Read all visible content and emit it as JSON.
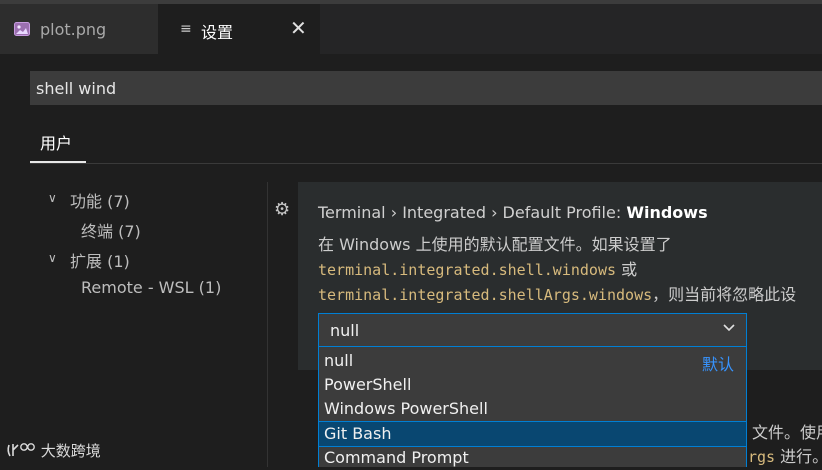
{
  "tabs": [
    {
      "label": "plot.png",
      "icon": "image-icon"
    },
    {
      "label": "设置",
      "icon": "list-icon",
      "close": "✕"
    }
  ],
  "search": {
    "value": "shell wind"
  },
  "scope": {
    "user_tab": "用户"
  },
  "toc": [
    {
      "chevron": "∨",
      "label": "功能 (7)"
    },
    {
      "label": "终端 (7)"
    },
    {
      "chevron": "∨",
      "label": "扩展 (1)"
    },
    {
      "label": "Remote - WSL (1)"
    }
  ],
  "setting": {
    "title_path": "Terminal › Integrated › Default Profile: ",
    "title_name": "Windows",
    "desc_line1": "在 Windows 上使用的默认配置文件。如果设置了",
    "code1": "terminal.integrated.shell.windows",
    "text_after_code1": " 或",
    "code2": "terminal.integrated.shellArgs.windows",
    "text_after_code2": "，则当前将忽略此设",
    "select_value": "null",
    "options": [
      "null",
      "PowerShell",
      "Windows PowerShell",
      "Git Bash",
      "Command Prompt"
    ],
    "default_label": "默认",
    "selected_option": "Git Bash",
    "tail_line1": "文件。使用",
    "tail_line2_code": "rgs",
    "tail_line2_text": " 进行。"
  },
  "watermark": "大数跨境",
  "colors": {
    "accent": "#007fd4",
    "selected": "#094771",
    "code": "#d7ba7d",
    "link": "#3794ff"
  }
}
